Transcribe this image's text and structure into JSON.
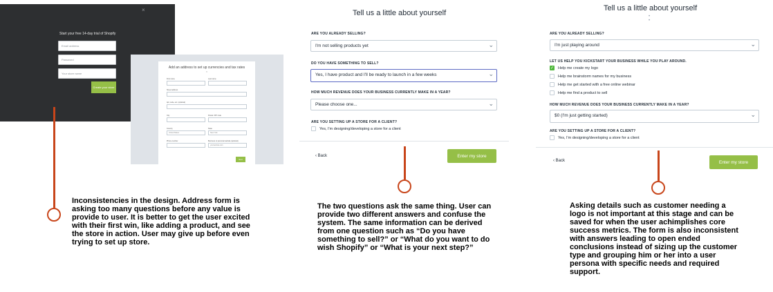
{
  "panel1": {
    "close": "×",
    "title": "Start your free 14-day trial of Shopify",
    "email_placeholder": "Email address",
    "password_placeholder": "Password",
    "store_placeholder": "Your store name",
    "create_button": "Create your store",
    "address": {
      "title": "Add an address to set up currencies and tax rates",
      "subtitle": "▾",
      "fields": {
        "first_name": "First name",
        "last_name": "Last name",
        "street": "Street address",
        "apt": "Apt, suite, etc. (optional)",
        "city": "City",
        "postal": "Postal / ZIP code",
        "country": "Country",
        "country_value": "United States",
        "state": "State",
        "state_value": "New York",
        "phone": "Phone number",
        "website": "Business or personal website (optional)",
        "website_placeholder": "yourwebsite.com"
      },
      "next_button": "Next"
    }
  },
  "panel2": {
    "title": "Tell us a little about yourself",
    "q1_label": "ARE YOU ALREADY SELLING?",
    "q1_value": "I'm not selling products yet",
    "q2_label": "DO YOU HAVE SOMETHING TO SELL?",
    "q2_value": "Yes, I have product and I'll be ready to launch in a few weeks",
    "q3_label": "HOW MUCH REVENUE DOES YOUR BUSINESS CURRENTLY MAKE IN A YEAR?",
    "q3_value": "Please choose one...",
    "q4_label": "ARE YOU SETTING UP A STORE FOR A CLIENT?",
    "q4_option": "Yes, I'm designing/developing a store for a client",
    "back": "‹ Back",
    "enter_button": "Enter my store"
  },
  "panel3": {
    "title": "Tell us a little about yourself",
    "dots": "• •",
    "q1_label": "ARE YOU ALREADY SELLING?",
    "q1_value": "I'm just playing around",
    "q2_label": "LET US HELP YOU KICKSTART YOUR BUSINESS WHILE YOU PLAY AROUND.",
    "options": [
      "Help me create my logo",
      "Help me brainstorm names for my business",
      "Help me get started with a free online webinar",
      "Help me find a product to sell"
    ],
    "q3_label": "HOW MUCH REVENUE DOES YOUR BUSINESS CURRENTLY MAKE IN A YEAR?",
    "q3_value": "$0 (I'm just getting started)",
    "q4_label": "ARE YOU SETTING UP A STORE FOR A CLIENT?",
    "q4_option": "Yes, I'm designing/developing a store for a client",
    "back": "‹ Back",
    "enter_button": "Enter my store"
  },
  "annotations": {
    "note1": "Inconsistencies in the design. Address form is asking too many questions before any value is provide to user. It is better to get the user excited with their first win, like adding a product, and see the store in action. User may give up before even trying to set up store.",
    "note2": "The two questions ask the same thing. User can provide two different answers and confuse the system. The same information can be derived from one question such as “Do you have something to sell?” or “What do you want to do wish Shopify” or “What is your next step?”",
    "note3": "Asking details such as customer needing a logo is not important at this stage and can be saved for when the user achimplishes core success metrics. The form is also inconsistent with answers leading to open ended conclusions instead of sizing up the customer type and grouping him or her into a user persona with specific needs and required support."
  },
  "colors": {
    "accent_green": "#95bf47",
    "pin_orange": "#c8451a",
    "dark_bg": "#2d2f31"
  }
}
